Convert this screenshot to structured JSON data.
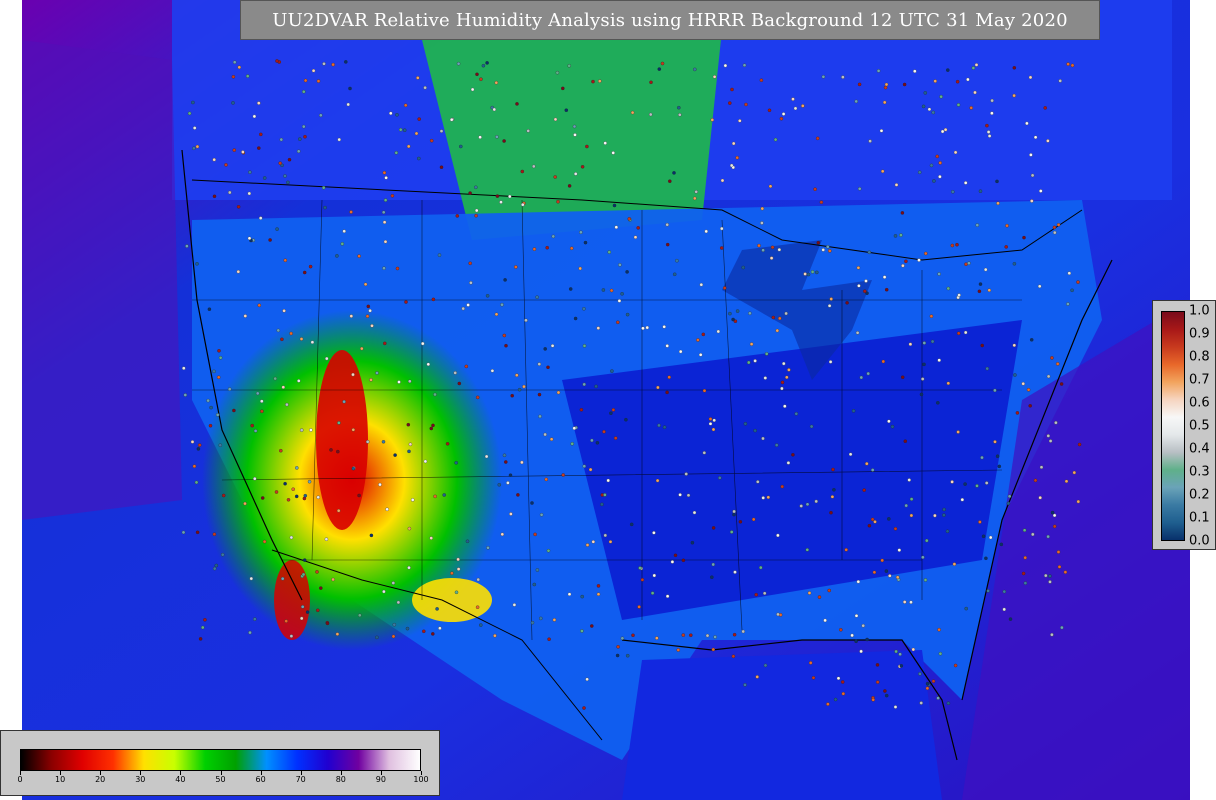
{
  "title": "UU2DVAR Relative Humidity Analysis using HRRR Background 12 UTC 31 May 2020",
  "map": {
    "field": "relative-humidity",
    "background_color": "#c8c8c8",
    "ocean_color": "#1a2fd6",
    "boundary_color": "#000000",
    "station_markers": true
  },
  "rh_colorbar": {
    "ticks": [
      "0",
      "10",
      "20",
      "30",
      "40",
      "50",
      "60",
      "70",
      "80",
      "90",
      "100"
    ],
    "colors": [
      "#000000",
      "#8b0000",
      "#e00000",
      "#ff3000",
      "#ffe000",
      "#c8ff00",
      "#00d000",
      "#00a000",
      "#0090ff",
      "#0030ff",
      "#2000d0",
      "#7000a0",
      "#e0c0e0",
      "#ffffff"
    ]
  },
  "ob_colorbar": {
    "ticks": [
      "0.0",
      "0.1",
      "0.2",
      "0.3",
      "0.4",
      "0.5",
      "0.6",
      "0.7",
      "0.8",
      "0.9",
      "1.0"
    ],
    "colors": [
      "#08306b",
      "#1f5f8f",
      "#3a7aa3",
      "#6aa3b8",
      "#5fb08a",
      "#b8bfc4",
      "#e4e8ea",
      "#f7f7f7",
      "#f6d5c0",
      "#f2a45e",
      "#e8682a",
      "#c83a1e",
      "#a81818",
      "#7a0b1a"
    ]
  }
}
